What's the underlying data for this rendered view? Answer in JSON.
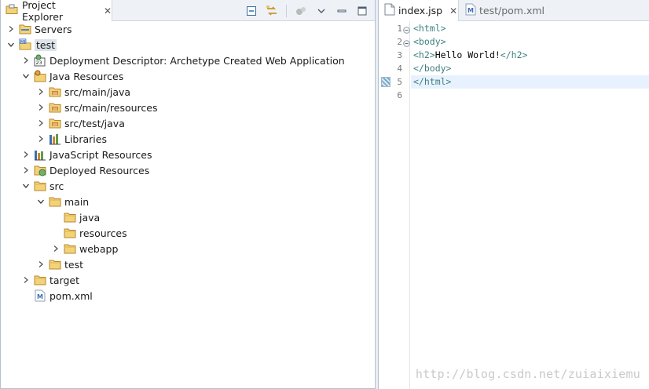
{
  "explorer": {
    "title": "Project Explorer",
    "close_glyph": "✕",
    "toolbar": [
      "collapse-all-icon",
      "link-with-editor-icon",
      "view-menu-icon",
      "chevron-down-icon",
      "minimize-icon",
      "maximize-icon"
    ],
    "items": [
      {
        "label": "Servers",
        "depth": 0,
        "expand": "closed",
        "icon": "folder-servers-icon"
      },
      {
        "label": "test",
        "depth": 0,
        "expand": "open",
        "icon": "web-project-icon",
        "selected": true
      },
      {
        "label": "Deployment Descriptor: Archetype Created Web Application",
        "depth": 1,
        "expand": "closed",
        "icon": "deployment-descriptor-icon"
      },
      {
        "label": "Java Resources",
        "depth": 1,
        "expand": "open",
        "icon": "java-resources-icon"
      },
      {
        "label": "src/main/java",
        "depth": 2,
        "expand": "closed",
        "icon": "source-folder-icon"
      },
      {
        "label": "src/main/resources",
        "depth": 2,
        "expand": "closed",
        "icon": "source-folder-icon"
      },
      {
        "label": "src/test/java",
        "depth": 2,
        "expand": "closed",
        "icon": "source-folder-icon"
      },
      {
        "label": "Libraries",
        "depth": 2,
        "expand": "closed",
        "icon": "libraries-icon"
      },
      {
        "label": "JavaScript Resources",
        "depth": 1,
        "expand": "closed",
        "icon": "javascript-resources-icon"
      },
      {
        "label": "Deployed Resources",
        "depth": 1,
        "expand": "closed",
        "icon": "deployed-resources-icon"
      },
      {
        "label": "src",
        "depth": 1,
        "expand": "open",
        "icon": "folder-icon"
      },
      {
        "label": "main",
        "depth": 2,
        "expand": "open",
        "icon": "folder-icon"
      },
      {
        "label": "java",
        "depth": 3,
        "expand": "none",
        "icon": "folder-icon"
      },
      {
        "label": "resources",
        "depth": 3,
        "expand": "none",
        "icon": "folder-icon"
      },
      {
        "label": "webapp",
        "depth": 3,
        "expand": "closed",
        "icon": "folder-icon"
      },
      {
        "label": "test",
        "depth": 2,
        "expand": "closed",
        "icon": "folder-icon"
      },
      {
        "label": "target",
        "depth": 1,
        "expand": "closed",
        "icon": "folder-icon"
      },
      {
        "label": "pom.xml",
        "depth": 1,
        "expand": "none",
        "icon": "maven-file-icon"
      }
    ]
  },
  "editor": {
    "tabs": [
      {
        "label": "index.jsp",
        "active": true,
        "icon": "jsp-file-icon",
        "close_glyph": "✕"
      },
      {
        "label": "test/pom.xml",
        "active": false,
        "icon": "maven-file-icon"
      }
    ],
    "current_line": 5,
    "lines": [
      {
        "num": "1",
        "fold": true,
        "parts": [
          {
            "t": "tag",
            "s": "<html>"
          }
        ]
      },
      {
        "num": "2",
        "fold": true,
        "parts": [
          {
            "t": "tag",
            "s": "<body>"
          }
        ]
      },
      {
        "num": "3",
        "fold": false,
        "parts": [
          {
            "t": "tag",
            "s": "<h2>"
          },
          {
            "t": "txt",
            "s": "Hello World!"
          },
          {
            "t": "tag",
            "s": "</h2>"
          }
        ]
      },
      {
        "num": "4",
        "fold": false,
        "parts": [
          {
            "t": "tag",
            "s": "</body>"
          }
        ]
      },
      {
        "num": "5",
        "fold": false,
        "parts": [
          {
            "t": "tag",
            "s": "</html>"
          }
        ]
      },
      {
        "num": "6",
        "fold": false,
        "parts": []
      }
    ]
  },
  "watermark": "http://blog.csdn.net/zuiaixiemu",
  "colors": {
    "tag": "#3f7f7f",
    "text": "#000000",
    "current_line": "#e8f2fe",
    "folder": "#e8b84a",
    "selection": "#dde3ea"
  }
}
